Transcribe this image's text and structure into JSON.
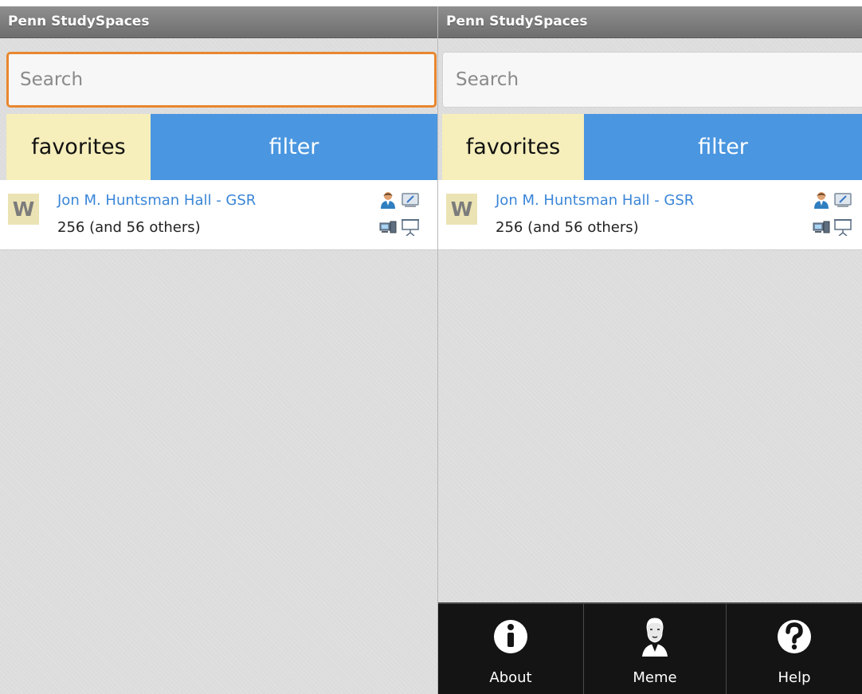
{
  "app": {
    "title": "Penn StudySpaces"
  },
  "search": {
    "placeholder": "Search"
  },
  "tabs": {
    "favorites": "favorites",
    "filter": "filter"
  },
  "results": [
    {
      "logo_letter": "W",
      "name": "Jon M. Huntsman Hall - GSR",
      "rooms": "256 (and 56 others)",
      "amenities": [
        "private-room-icon",
        "whiteboard-icon",
        "computer-icon",
        "projector-icon"
      ]
    }
  ],
  "menu": [
    {
      "label": "About",
      "icon": "info-icon"
    },
    {
      "label": "Meme",
      "icon": "meme-portrait-icon"
    },
    {
      "label": "Help",
      "icon": "help-icon"
    }
  ],
  "colors": {
    "title_bar": "#7d7d7d",
    "search_focus": "#e8872f",
    "favorites_tab": "#f6eebb",
    "filter_tab": "#4a96e0",
    "link": "#3b86d8",
    "menu_bg": "#141414"
  }
}
